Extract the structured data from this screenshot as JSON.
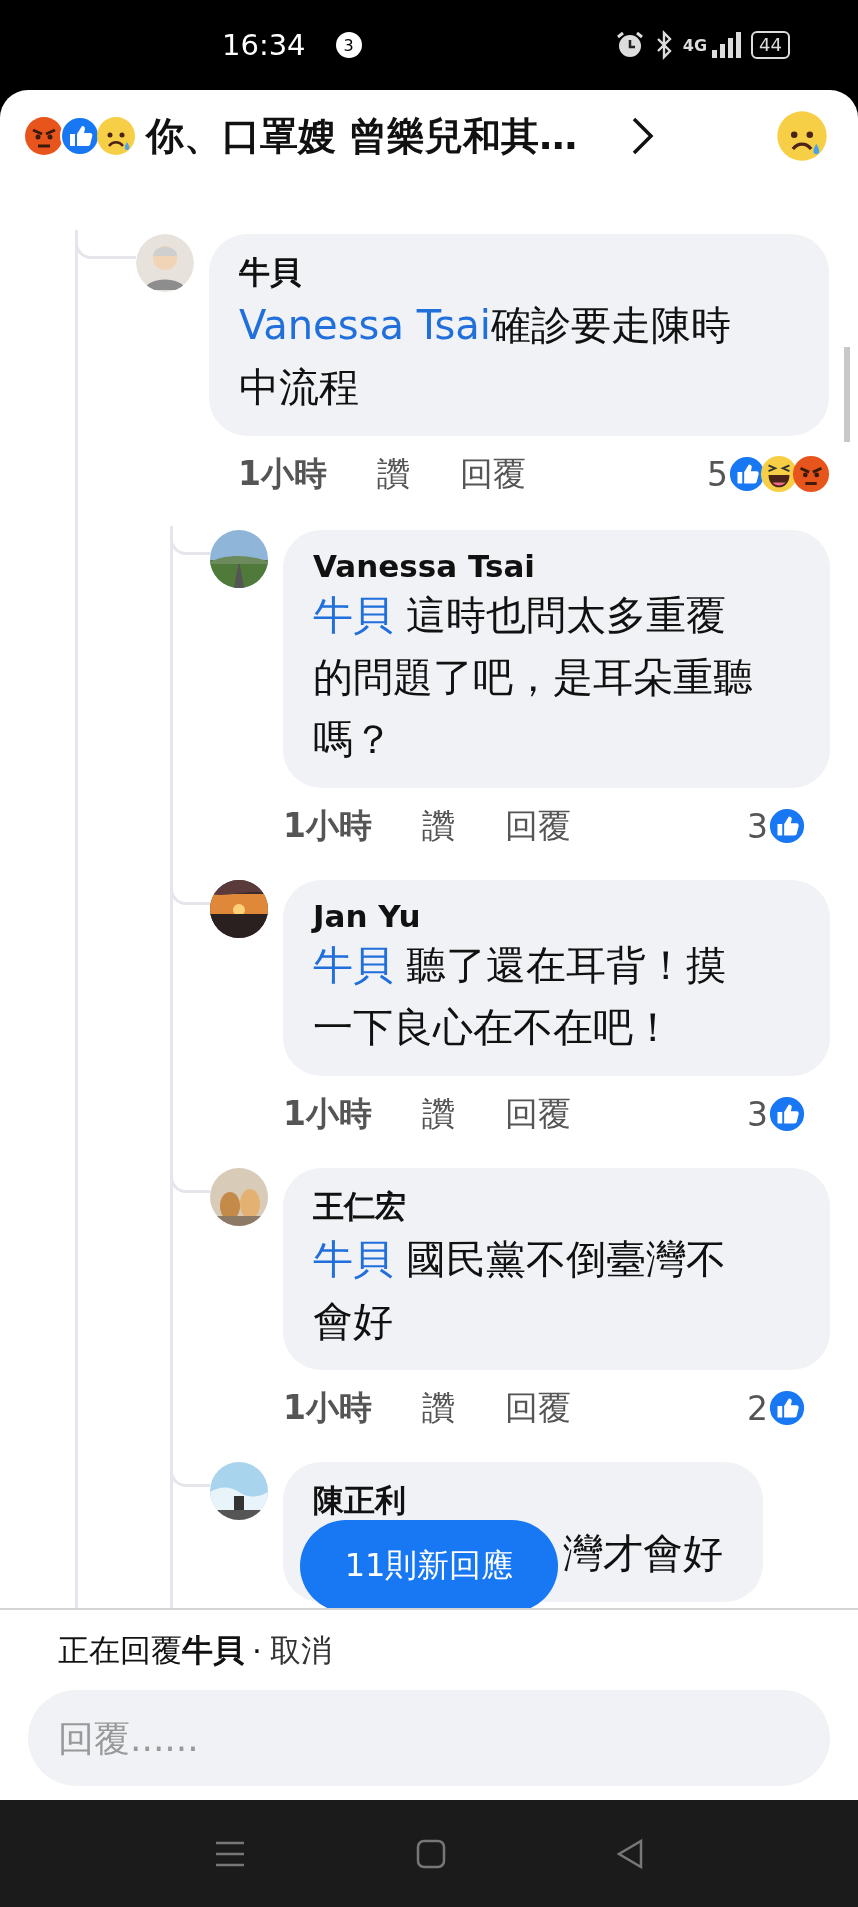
{
  "status_bar": {
    "time": "16:34",
    "notification_count": "3",
    "network": "4G",
    "battery": "44"
  },
  "header": {
    "title": "你、口罩嫂 曾樂兒和其…"
  },
  "comment": {
    "author": "牛貝",
    "mention": "Vanessa Tsai",
    "text": "確診要走陳時中流程",
    "time": "1小時",
    "like": "讚",
    "reply": "回覆",
    "reaction_count": "5",
    "replies": [
      {
        "author": "Vanessa Tsai",
        "mention": "牛貝",
        "text": " 這時也問太多重覆的問題了吧，是耳朵重聽嗎？",
        "time": "1小時",
        "like": "讚",
        "reply": "回覆",
        "reaction_count": "3"
      },
      {
        "author": "Jan Yu",
        "mention": "牛貝",
        "text": " 聽了還在耳背！摸一下良心在不在吧！",
        "time": "1小時",
        "like": "讚",
        "reply": "回覆",
        "reaction_count": "3"
      },
      {
        "author": "王仁宏",
        "mention": "牛貝",
        "text": " 國民黨不倒臺灣不會好",
        "time": "1小時",
        "like": "讚",
        "reply": "回覆",
        "reaction_count": "2"
      },
      {
        "author": "陳正利",
        "text": "灣才會好",
        "covered": true
      }
    ]
  },
  "new_replies_button": "11則新回應",
  "composer": {
    "replying_to": "正在回覆**牛貝**",
    "separator": "·",
    "cancel": "取消",
    "placeholder": "回覆......"
  }
}
